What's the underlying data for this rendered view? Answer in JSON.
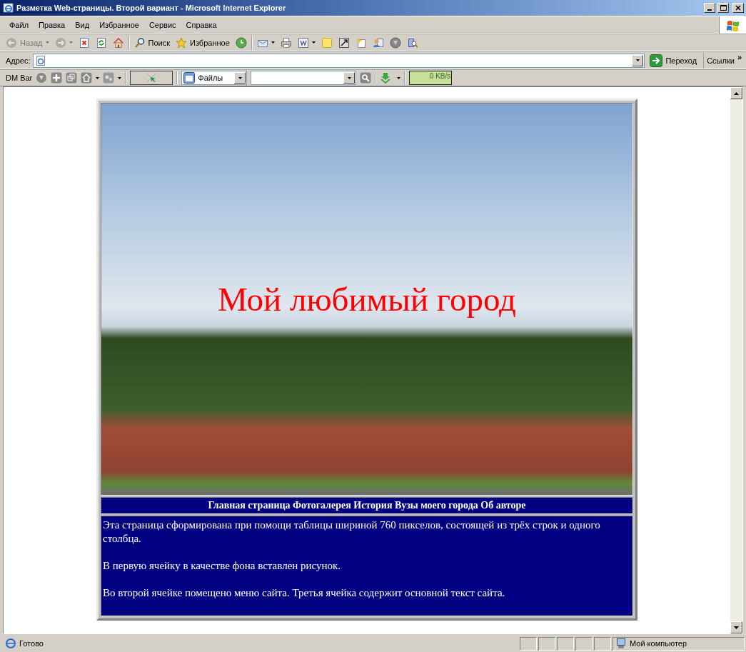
{
  "window": {
    "title": "Разметка Web-страницы. Второй вариант - Microsoft Internet Explorer"
  },
  "menu": [
    "Файл",
    "Правка",
    "Вид",
    "Избранное",
    "Сервис",
    "Справка"
  ],
  "toolbar": [
    [
      {
        "kind": "back",
        "label": "Назад",
        "disabled": true,
        "dropdown": true
      },
      {
        "kind": "forward",
        "disabled": true,
        "dropdown": true
      },
      {
        "kind": "stop",
        "disabled": false,
        "dropdown": false
      },
      {
        "kind": "refresh",
        "disabled": false,
        "dropdown": false
      },
      {
        "kind": "home",
        "disabled": false,
        "dropdown": false
      }
    ],
    [
      {
        "kind": "search",
        "label": "Поиск",
        "disabled": false,
        "dropdown": false
      },
      {
        "kind": "favorites",
        "label": "Избранное",
        "disabled": false,
        "dropdown": false
      },
      {
        "kind": "history",
        "disabled": false,
        "dropdown": false
      }
    ],
    [
      {
        "kind": "mail",
        "disabled": false,
        "dropdown": true
      },
      {
        "kind": "print",
        "disabled": false,
        "dropdown": false
      },
      {
        "kind": "edit",
        "disabled": false,
        "dropdown": true
      },
      {
        "kind": "note",
        "disabled": false,
        "dropdown": false
      },
      {
        "kind": "resize",
        "disabled": false,
        "dropdown": false
      },
      {
        "kind": "sparkle",
        "disabled": false,
        "dropdown": false
      },
      {
        "kind": "messenger",
        "disabled": false,
        "dropdown": false
      },
      {
        "kind": "gear",
        "disabled": false,
        "dropdown": false
      },
      {
        "kind": "research",
        "disabled": false,
        "dropdown": false
      }
    ]
  ],
  "address_bar": {
    "label": "Адрес:",
    "go": "Переход",
    "links": "Ссылки",
    "more": "»"
  },
  "dm_bar": {
    "label": "DM Bar",
    "files": "Файлы",
    "speed": "0 KB/s"
  },
  "page": {
    "heading": "Мой любимый город",
    "nav": "Главная страница Фотогалерея История Вузы моего города Об авторе",
    "paragraphs": [
      "Эта страница сформирована при помощи таблицы шириной 760 пикселов, состоящей из трёх строк и одного столбца.",
      "В первую ячейку в качестве фона вставлен рисунок.",
      "Во второй ячейке помещено меню сайта. Третья ячейка содержит основной текст сайта."
    ]
  },
  "status_bar": {
    "text": "Готово",
    "zone": "Мой компьютер"
  }
}
